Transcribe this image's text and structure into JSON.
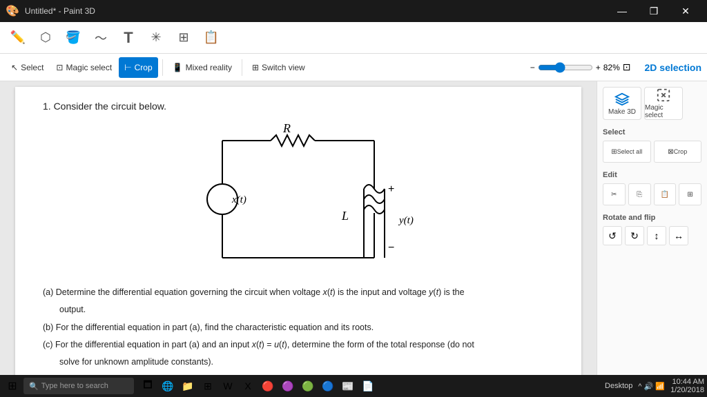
{
  "window": {
    "title": "Untitled* - Paint 3D",
    "controls": [
      "—",
      "❐",
      "✕"
    ]
  },
  "toolbar": {
    "icons": [
      "pencil",
      "rotate",
      "shape",
      "curve",
      "text",
      "effects",
      "crop_icon",
      "layers"
    ]
  },
  "secondary_toolbar": {
    "select_label": "Select",
    "magic_select_label": "Magic select",
    "crop_label": "Crop",
    "mixed_reality_label": "Mixed reality",
    "switch_view_label": "Switch view",
    "zoom": "82%",
    "section_title": "2D selection"
  },
  "right_panel": {
    "make3d_label": "Make 3D",
    "magic_select_label": "Magic select",
    "select_section": "Select",
    "select_all_label": "Select all",
    "crop_label": "Crop",
    "edit_section": "Edit",
    "edit_btns": [
      "X",
      "↑",
      "□",
      "⊞"
    ],
    "rotate_section": "Rotate and flip",
    "rotate_btns": [
      "↺",
      "↻",
      "↕",
      "↔"
    ]
  },
  "canvas": {
    "problem_header": "1.  Consider the circuit below.",
    "parts": [
      "(a)  Determine the differential equation governing the circuit when voltage x(t) is the input and voltage y(t) is the output.",
      "(b)  For the differential equation in part (a), find the characteristic equation and its roots.",
      "(c)  For the differential equation in part (a) and an input x(t) = u(t), determine the form of the total response (do not solve for unknown amplitude constants)."
    ],
    "circuit": {
      "R_label": "R",
      "L_label": "L",
      "xt_label": "x(t)",
      "yt_label": "y(t)",
      "plus": "+",
      "minus": "−"
    }
  },
  "taskbar": {
    "search_placeholder": "Type here to search",
    "time": "10:44 AM",
    "date": "1/20/2018",
    "desktop_label": "Desktop"
  }
}
